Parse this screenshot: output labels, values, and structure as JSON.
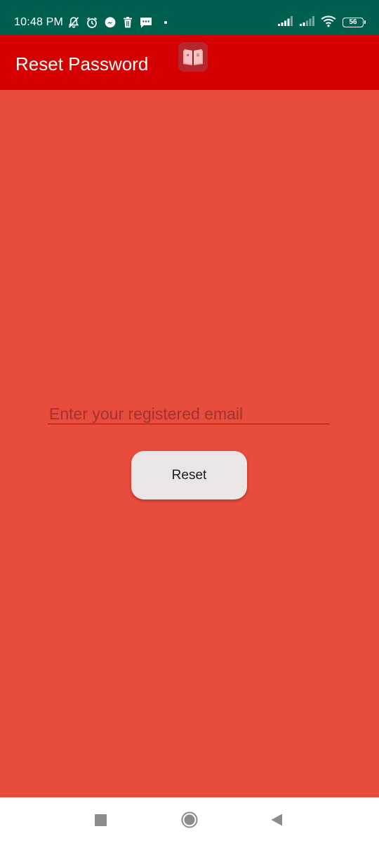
{
  "status_bar": {
    "time": "10:48 PM",
    "battery_level": "56",
    "icons_left": [
      "notifications-off-icon",
      "alarm-icon",
      "messenger-icon",
      "trash-icon",
      "message-icon",
      "dot-icon"
    ],
    "icons_right": [
      "signal-icon",
      "signal-icon",
      "wifi-icon",
      "battery-icon"
    ]
  },
  "app_bar": {
    "title": "Reset Password",
    "logo_icon": "book-icon"
  },
  "form": {
    "email_placeholder": "Enter your registered email",
    "email_value": "",
    "reset_label": "Reset"
  },
  "nav_bar": {
    "icons": [
      "recents-icon",
      "home-icon",
      "back-icon"
    ]
  },
  "colors": {
    "status_bar": "#006050",
    "app_bar": "#d50000",
    "background": "#e84c3d",
    "button": "#ebe5e5",
    "nav_bar": "#ffffff"
  }
}
